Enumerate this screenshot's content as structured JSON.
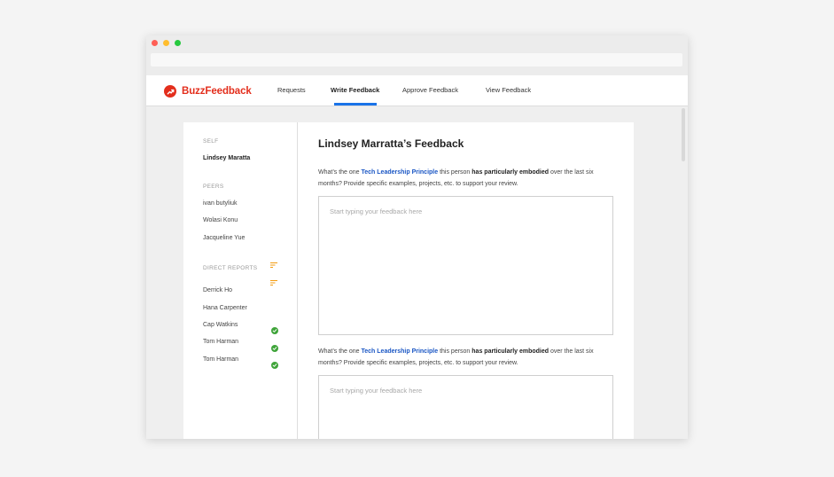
{
  "app": {
    "name": "BuzzFeedback",
    "brand_color": "#e32e1c",
    "accent_color": "#1a73e8"
  },
  "nav": {
    "items": [
      {
        "label": "Requests"
      },
      {
        "label": "Write Feedback",
        "active": true
      },
      {
        "label": "Approve Feedback"
      },
      {
        "label": "View Feedback"
      }
    ]
  },
  "sidebar": {
    "self_label": "SELF",
    "self_name": "Lindsey Maratta",
    "peers_label": "PEERS",
    "peers": [
      "ivan butyliuk",
      "Wolasi Konu",
      "Jacqueline Yue"
    ],
    "direct_reports_label": "DIRECT REPORTS",
    "direct_reports": [
      "Derrick Ho",
      "Hana Carpenter",
      "Cap Watkins",
      "Tom Harman",
      "Tom Harman"
    ],
    "icons": {
      "sort": "sort-lines-icon",
      "done": "check-circle-icon"
    }
  },
  "main": {
    "title": "Lindsey Marratta’s Feedback",
    "questions": [
      {
        "prefix": "What’s the one ",
        "link": "Tech Leadership Principle",
        "middle": " this person ",
        "emphasis": "has particularly embodied",
        "suffix": " over the last six months? Provide specific examples, projects, etc. to support your review.",
        "placeholder": "Start typing your feedback here"
      },
      {
        "prefix": "What’s the one ",
        "link": "Tech Leadership Principle",
        "middle": " this person ",
        "emphasis": "has particularly embodied",
        "suffix": " over the last six months? Provide specific examples, projects, etc. to support your review.",
        "placeholder": "Start typing your feedback here"
      }
    ]
  }
}
